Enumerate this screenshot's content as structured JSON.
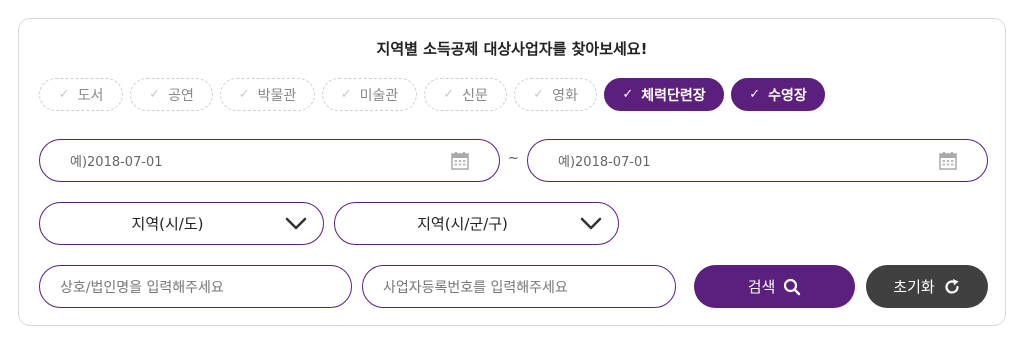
{
  "title": "지역별 소득공제 대상사업자를 찾아보세요!",
  "categories": [
    {
      "label": "도서",
      "selected": false
    },
    {
      "label": "공연",
      "selected": false
    },
    {
      "label": "박물관",
      "selected": false
    },
    {
      "label": "미술관",
      "selected": false
    },
    {
      "label": "신문",
      "selected": false
    },
    {
      "label": "영화",
      "selected": false
    },
    {
      "label": "체력단련장",
      "selected": true
    },
    {
      "label": "수영장",
      "selected": true
    }
  ],
  "date_range": {
    "start_placeholder": "예)2018-07-01",
    "end_placeholder": "예)2018-07-01",
    "separator": "~"
  },
  "region": {
    "province_label": "지역(시/도)",
    "district_label": "지역(시/군/구)"
  },
  "inputs": {
    "business_name_placeholder": "상호/법인명을 입력해주세요",
    "business_number_placeholder": "사업자등록번호를 입력해주세요"
  },
  "buttons": {
    "search_label": "검색",
    "reset_label": "초기화"
  },
  "icons": {
    "check": "check-icon",
    "calendar": "calendar-icon",
    "chevron": "chevron-down-icon",
    "search": "search-icon",
    "refresh": "refresh-icon"
  },
  "colors": {
    "accent": "#5b1f7e",
    "reset_button": "#404040",
    "chip_border": "#cfcfcf"
  }
}
